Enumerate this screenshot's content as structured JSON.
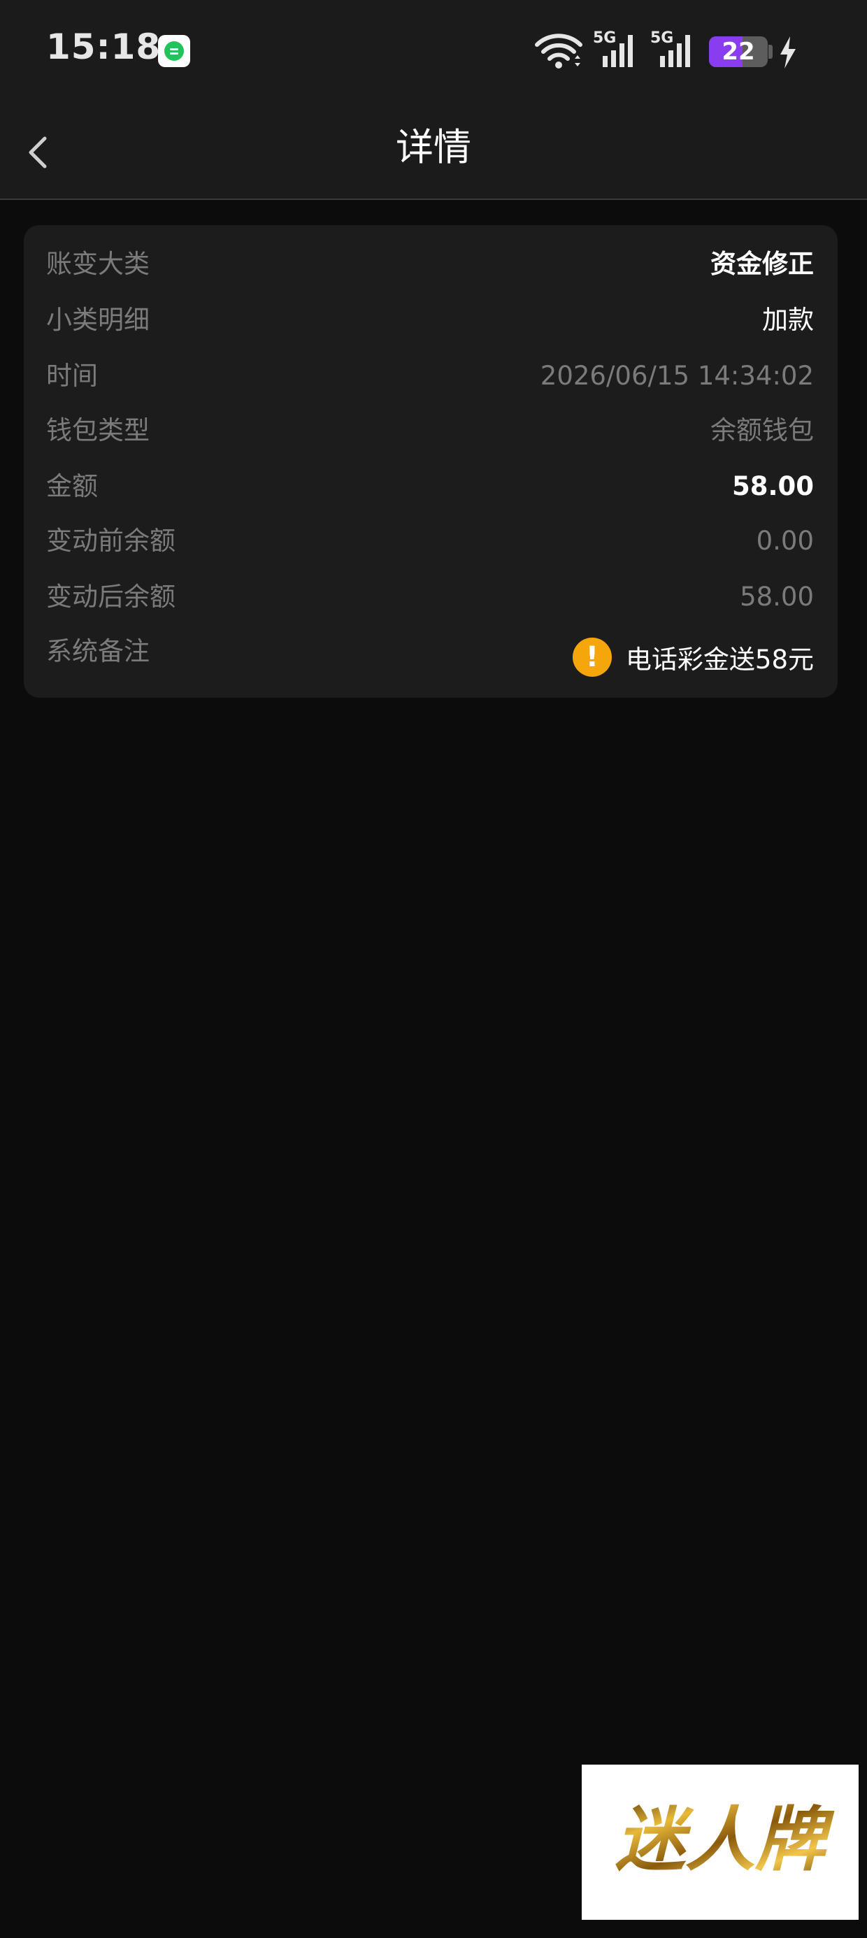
{
  "status_bar": {
    "time": "15:18",
    "network_1": "5G",
    "network_2": "5G",
    "battery_level": "22",
    "battery_fraction": 0.22,
    "icons": [
      "message-app-icon",
      "wifi-icon",
      "signal-icon",
      "signal-icon",
      "battery-icon",
      "charging-icon"
    ]
  },
  "header": {
    "title": "详情",
    "back_icon": "chevron-left-icon"
  },
  "detail": {
    "rows": [
      {
        "label": "账变大类",
        "value": "资金修正"
      },
      {
        "label": "小类明细",
        "value": "加款"
      },
      {
        "label": "时间",
        "value": "2026/06/15 14:34:02"
      },
      {
        "label": "钱包类型",
        "value": "余额钱包"
      },
      {
        "label": "金额",
        "value": "58.00"
      },
      {
        "label": "变动前余额",
        "value": "0.00"
      },
      {
        "label": "变动后余额",
        "value": "58.00"
      },
      {
        "label": "系统备注",
        "value": "电话彩金送58元"
      }
    ]
  },
  "watermark": {
    "text": "迷人牌"
  },
  "colors": {
    "background": "#0c0c0c",
    "card": "#1c1c1c",
    "warning": "#f5a60a",
    "battery_accent": "#8a3cf0"
  }
}
